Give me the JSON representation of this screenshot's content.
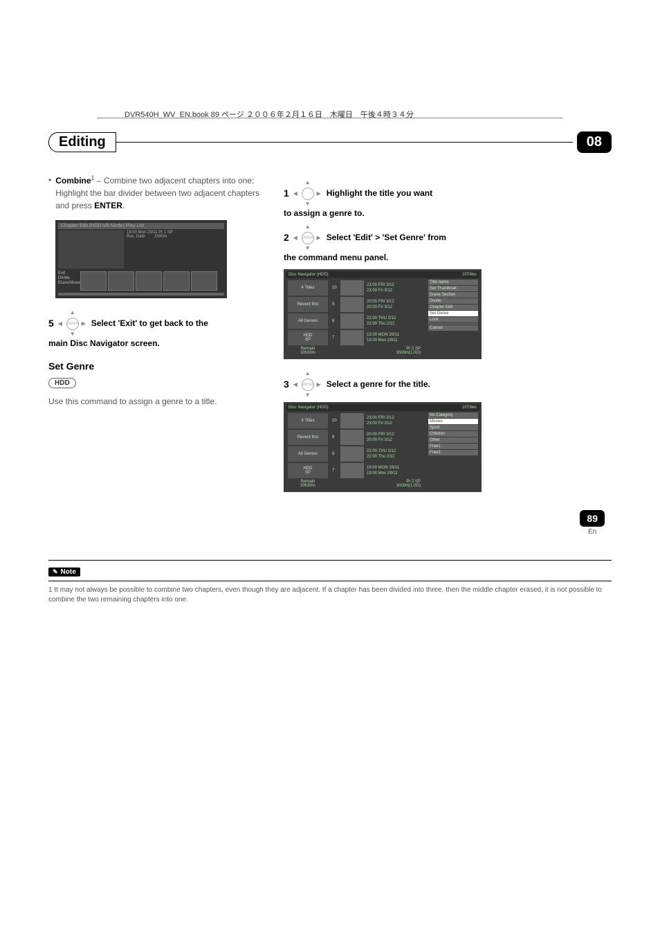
{
  "book_header": "DVR540H_WV_EN.book  89 ページ  ２００６年２月１６日　木曜日　午後４時３４分",
  "header": {
    "label": "Editing",
    "badge": "08"
  },
  "left": {
    "combine": {
      "title": "Combine",
      "sup": "1",
      "body": " – Combine two adjacent chapters into one: Highlight the bar divider between two adjacent chapters and press ",
      "enter": "ENTER",
      "period": "."
    },
    "ss1": {
      "topbar_left": "Chapter Edit (HDD:VR Mode) Play List",
      "info1": "19:00  Mon  29/11  Pr 1  SP",
      "info2": "Rec. Date",
      "info3": "1h00m",
      "buttons": [
        "Exit",
        "Divide",
        "Erase/Move"
      ]
    },
    "step5": {
      "num": "5",
      "enter": "ENTER",
      "text": "Select 'Exit' to get back to the",
      "cont": "main Disc Navigator screen."
    },
    "subhead": "Set Genre",
    "hdd": "HDD",
    "body": "Use this command to assign a genre to a title."
  },
  "right": {
    "step1": {
      "num": "1",
      "text": "Highlight the title you want",
      "cont": "to assign a genre to."
    },
    "step2": {
      "num": "2",
      "enter": "ENTER",
      "text": "Select 'Edit' > 'Set Genre' from",
      "cont": "the command menu panel."
    },
    "nav1": {
      "title": "Disc Navigator (HDD)",
      "count": "10Titles",
      "left_items": [
        "4 Titles",
        "Recent first",
        "All Genres",
        "HDD\nSP",
        "Remain\n30h30m"
      ],
      "rows": [
        {
          "n": "10",
          "l1": "23:00  FRI  3/12",
          "l2": "23:00  Fri  3/12"
        },
        {
          "n": "9",
          "l1": "20:00  FRI  3/12",
          "l2": "20:00  Fri  3/12"
        },
        {
          "n": "8",
          "l1": "22:00  THU  2/12",
          "l2": "22:00  Thu  2/12"
        },
        {
          "n": "7",
          "l1": "19:00  MON  29/11",
          "l2": "19:00  Mon  29/11"
        }
      ],
      "menu": [
        "Title name",
        "Set Thumbnail",
        "Erase Section",
        "Divide",
        "Chapter Edit",
        "Set Genre",
        "Lock",
        "",
        "Cancel"
      ],
      "menu_hi_index": 5,
      "extra1": "Pr 2  SP",
      "extra2": "1h00m(1.0G)"
    },
    "step3": {
      "num": "3",
      "enter": "ENTER",
      "text": "Select a genre for the title."
    },
    "nav2": {
      "title": "Disc Navigator (HDD)",
      "count": "10Titles",
      "left_items": [
        "4 Titles",
        "Recent first",
        "All Genres",
        "HDD\nSP",
        "Remain\n30h30m"
      ],
      "rows": [
        {
          "n": "10",
          "l1": "23:00  FRI  3/12",
          "l2": "23:00  Fri  3/12"
        },
        {
          "n": "9",
          "l1": "20:00  FRI  3/12",
          "l2": "20:00  Fri  3/12"
        },
        {
          "n": "8",
          "l1": "22:00  THU  2/12",
          "l2": "22:00  Thu  2/12"
        },
        {
          "n": "7",
          "l1": "19:00  MON  29/11",
          "l2": "19:00  Mon  29/11"
        }
      ],
      "menu": [
        "No Category",
        "Movies",
        "Sport",
        "Children",
        "Other",
        "Free1",
        "Free2"
      ],
      "menu_hi_index": 1,
      "extra1": "Pr 2  SP",
      "extra2": "1h00m(1.0G)"
    }
  },
  "note": {
    "label": "Note",
    "footnote_num": "1",
    "footnote": " It may not always be possible to combine two chapters, even though they are adjacent. If a chapter has been divided into three, then the middle chapter erased, it is not possible to combine the two remaining chapters into one."
  },
  "page": {
    "num": "89",
    "lang": "En"
  }
}
